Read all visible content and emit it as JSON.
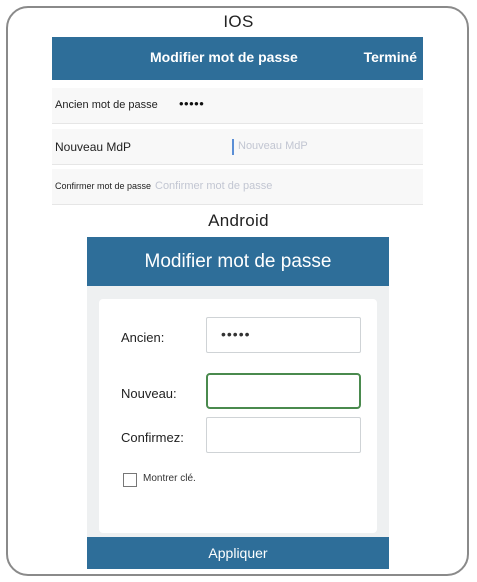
{
  "ios": {
    "section_label": "IOS",
    "nav": {
      "title": "Modifier mot de passe",
      "done": "Terminé"
    },
    "rows": [
      {
        "label": "Ancien mot de passe",
        "value": "•••••"
      },
      {
        "label": "Nouveau MdP",
        "placeholder": "Nouveau MdP"
      },
      {
        "label": "Confirmer mot de passe",
        "placeholder": "Confirmer mot de passe"
      }
    ]
  },
  "android": {
    "section_label": "Android",
    "header_title": "Modifier mot de passe",
    "fields": [
      {
        "label": "Ancien:",
        "value": "•••••"
      },
      {
        "label": "Nouveau:",
        "value": ""
      },
      {
        "label": "Confirmez:",
        "value": ""
      }
    ],
    "show_key_label": "Montrer clé.",
    "show_key_checked": false,
    "apply_label": "Appliquer"
  },
  "colors": {
    "accent": "#2e6e99",
    "focus_border": "#4a8a4e",
    "placeholder": "#c2c6d2"
  }
}
